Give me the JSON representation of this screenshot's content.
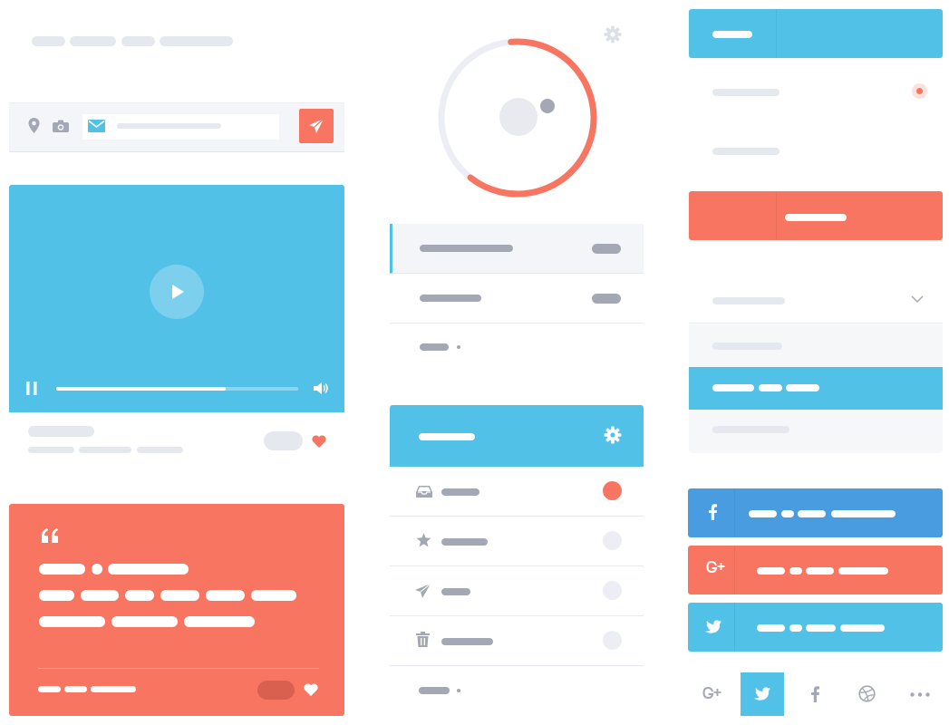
{
  "colors": {
    "accent_blue": "#51c1e8",
    "accent_coral": "#f87562",
    "facebook_blue": "#4a9ce0",
    "muted_gray": "#a3a8b4",
    "light_gray": "#e5e8ee"
  },
  "video_player": {
    "progress": 0.7
  },
  "icons": {
    "location": "map-pin",
    "camera": "camera",
    "mail": "envelope",
    "send": "paper-plane",
    "play": "play",
    "pause": "pause",
    "volume": "speaker",
    "heart": "heart",
    "quote": "quotation-mark",
    "settings": "gear",
    "inbox": "tray",
    "star": "star",
    "trash": "trash-can",
    "chevron": "chevron-down",
    "facebook": "f",
    "google_plus": "g+",
    "twitter": "bird",
    "dribbble": "ball",
    "more": "ellipsis"
  },
  "progress_ring": {
    "progress": 0.62
  },
  "folders": {
    "unread_indicator_row": 0
  },
  "dropdown": {
    "selected_index": 1
  },
  "social_tabs": {
    "active_index": 1
  }
}
